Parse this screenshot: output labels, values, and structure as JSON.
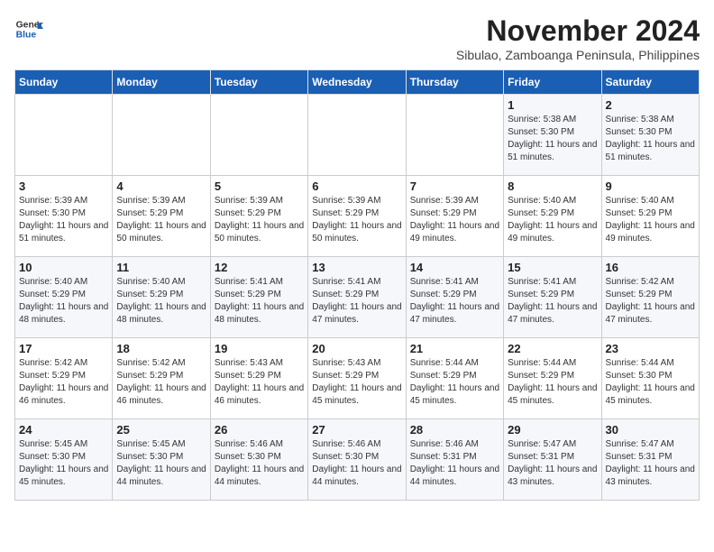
{
  "logo": {
    "text_general": "General",
    "text_blue": "Blue"
  },
  "header": {
    "month_title": "November 2024",
    "subtitle": "Sibulao, Zamboanga Peninsula, Philippines"
  },
  "days_of_week": [
    "Sunday",
    "Monday",
    "Tuesday",
    "Wednesday",
    "Thursday",
    "Friday",
    "Saturday"
  ],
  "weeks": [
    [
      {
        "day": "",
        "info": ""
      },
      {
        "day": "",
        "info": ""
      },
      {
        "day": "",
        "info": ""
      },
      {
        "day": "",
        "info": ""
      },
      {
        "day": "",
        "info": ""
      },
      {
        "day": "1",
        "info": "Sunrise: 5:38 AM\nSunset: 5:30 PM\nDaylight: 11 hours and 51 minutes."
      },
      {
        "day": "2",
        "info": "Sunrise: 5:38 AM\nSunset: 5:30 PM\nDaylight: 11 hours and 51 minutes."
      }
    ],
    [
      {
        "day": "3",
        "info": "Sunrise: 5:39 AM\nSunset: 5:30 PM\nDaylight: 11 hours and 51 minutes."
      },
      {
        "day": "4",
        "info": "Sunrise: 5:39 AM\nSunset: 5:29 PM\nDaylight: 11 hours and 50 minutes."
      },
      {
        "day": "5",
        "info": "Sunrise: 5:39 AM\nSunset: 5:29 PM\nDaylight: 11 hours and 50 minutes."
      },
      {
        "day": "6",
        "info": "Sunrise: 5:39 AM\nSunset: 5:29 PM\nDaylight: 11 hours and 50 minutes."
      },
      {
        "day": "7",
        "info": "Sunrise: 5:39 AM\nSunset: 5:29 PM\nDaylight: 11 hours and 49 minutes."
      },
      {
        "day": "8",
        "info": "Sunrise: 5:40 AM\nSunset: 5:29 PM\nDaylight: 11 hours and 49 minutes."
      },
      {
        "day": "9",
        "info": "Sunrise: 5:40 AM\nSunset: 5:29 PM\nDaylight: 11 hours and 49 minutes."
      }
    ],
    [
      {
        "day": "10",
        "info": "Sunrise: 5:40 AM\nSunset: 5:29 PM\nDaylight: 11 hours and 48 minutes."
      },
      {
        "day": "11",
        "info": "Sunrise: 5:40 AM\nSunset: 5:29 PM\nDaylight: 11 hours and 48 minutes."
      },
      {
        "day": "12",
        "info": "Sunrise: 5:41 AM\nSunset: 5:29 PM\nDaylight: 11 hours and 48 minutes."
      },
      {
        "day": "13",
        "info": "Sunrise: 5:41 AM\nSunset: 5:29 PM\nDaylight: 11 hours and 47 minutes."
      },
      {
        "day": "14",
        "info": "Sunrise: 5:41 AM\nSunset: 5:29 PM\nDaylight: 11 hours and 47 minutes."
      },
      {
        "day": "15",
        "info": "Sunrise: 5:41 AM\nSunset: 5:29 PM\nDaylight: 11 hours and 47 minutes."
      },
      {
        "day": "16",
        "info": "Sunrise: 5:42 AM\nSunset: 5:29 PM\nDaylight: 11 hours and 47 minutes."
      }
    ],
    [
      {
        "day": "17",
        "info": "Sunrise: 5:42 AM\nSunset: 5:29 PM\nDaylight: 11 hours and 46 minutes."
      },
      {
        "day": "18",
        "info": "Sunrise: 5:42 AM\nSunset: 5:29 PM\nDaylight: 11 hours and 46 minutes."
      },
      {
        "day": "19",
        "info": "Sunrise: 5:43 AM\nSunset: 5:29 PM\nDaylight: 11 hours and 46 minutes."
      },
      {
        "day": "20",
        "info": "Sunrise: 5:43 AM\nSunset: 5:29 PM\nDaylight: 11 hours and 45 minutes."
      },
      {
        "day": "21",
        "info": "Sunrise: 5:44 AM\nSunset: 5:29 PM\nDaylight: 11 hours and 45 minutes."
      },
      {
        "day": "22",
        "info": "Sunrise: 5:44 AM\nSunset: 5:29 PM\nDaylight: 11 hours and 45 minutes."
      },
      {
        "day": "23",
        "info": "Sunrise: 5:44 AM\nSunset: 5:30 PM\nDaylight: 11 hours and 45 minutes."
      }
    ],
    [
      {
        "day": "24",
        "info": "Sunrise: 5:45 AM\nSunset: 5:30 PM\nDaylight: 11 hours and 45 minutes."
      },
      {
        "day": "25",
        "info": "Sunrise: 5:45 AM\nSunset: 5:30 PM\nDaylight: 11 hours and 44 minutes."
      },
      {
        "day": "26",
        "info": "Sunrise: 5:46 AM\nSunset: 5:30 PM\nDaylight: 11 hours and 44 minutes."
      },
      {
        "day": "27",
        "info": "Sunrise: 5:46 AM\nSunset: 5:30 PM\nDaylight: 11 hours and 44 minutes."
      },
      {
        "day": "28",
        "info": "Sunrise: 5:46 AM\nSunset: 5:31 PM\nDaylight: 11 hours and 44 minutes."
      },
      {
        "day": "29",
        "info": "Sunrise: 5:47 AM\nSunset: 5:31 PM\nDaylight: 11 hours and 43 minutes."
      },
      {
        "day": "30",
        "info": "Sunrise: 5:47 AM\nSunset: 5:31 PM\nDaylight: 11 hours and 43 minutes."
      }
    ]
  ]
}
